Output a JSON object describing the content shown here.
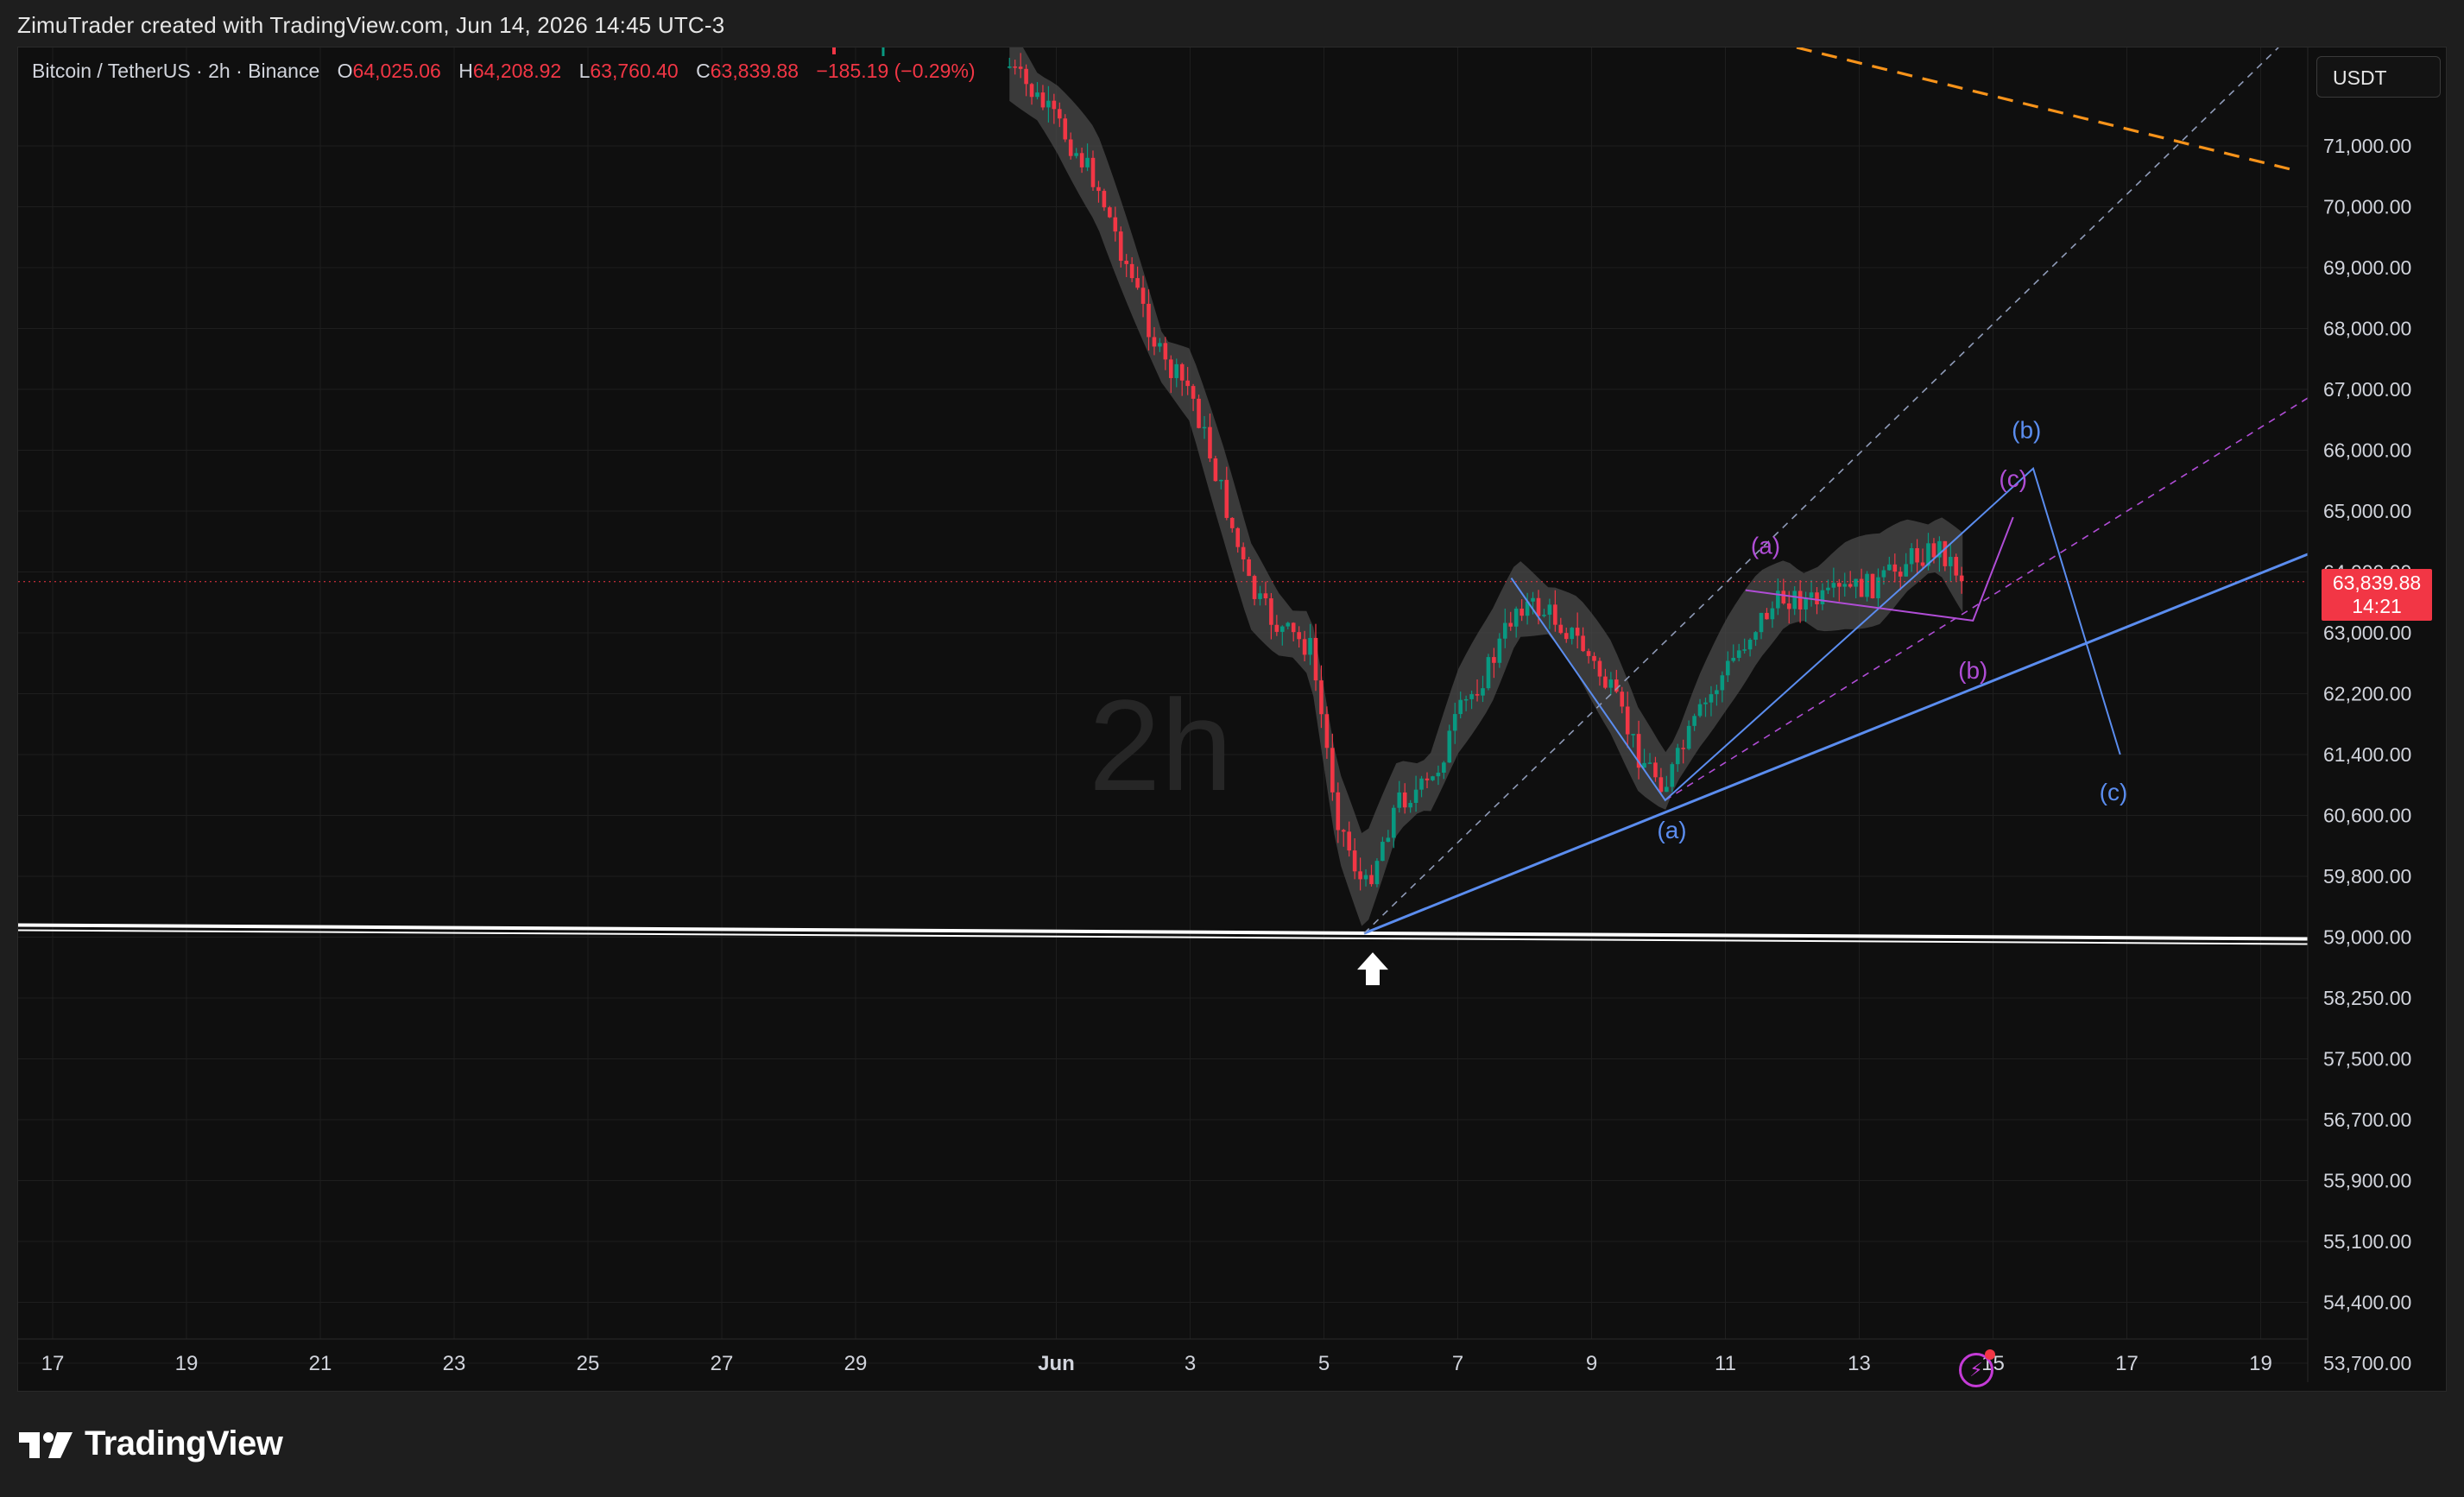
{
  "attribution": "ZimuTrader created with TradingView.com, Jun 14, 2026 14:45 UTC-3",
  "legend": {
    "symbol": "Bitcoin / TetherUS · 2h · Binance",
    "open_label": "O",
    "open": "64,025.06",
    "high_label": "H",
    "high": "64,208.92",
    "low_label": "L",
    "low": "63,760.40",
    "close_label": "C",
    "close": "63,839.88",
    "change": "−185.19 (−0.29%)"
  },
  "currency": "USDT",
  "price_tag": {
    "price": "63,839.88",
    "countdown": "14:21"
  },
  "watermark": "2h",
  "footer": {
    "brand": "TradingView"
  },
  "colors": {
    "bear": "#f23645",
    "bull": "#089981",
    "blue": "#5b8def",
    "purple": "#b04dd6",
    "orange": "#f7931a",
    "support": "#ffffff",
    "cloud": "#4a4a4a"
  },
  "icons": [
    "up-arrow-icon",
    "lightning-icon",
    "tradingview-logo-icon"
  ],
  "chart_data": {
    "type": "candlestick",
    "timeframe": "2h",
    "y_axis": {
      "labels": [
        "71,000.00",
        "70,000.00",
        "69,000.00",
        "68,000.00",
        "67,000.00",
        "66,000.00",
        "65,000.00",
        "64,000.00",
        "63,000.00",
        "62,200.00",
        "61,400.00",
        "60,600.00",
        "59,800.00",
        "59,000.00",
        "58,250.00",
        "57,500.00",
        "56,700.00",
        "55,900.00",
        "55,100.00",
        "54,400.00",
        "53,700.00"
      ],
      "values": [
        71000,
        70000,
        69000,
        68000,
        67000,
        66000,
        65000,
        64000,
        63000,
        62200,
        61400,
        60600,
        59800,
        59000,
        58250,
        57500,
        56700,
        55900,
        55100,
        54400,
        53700
      ]
    },
    "x_axis": {
      "labels": [
        "17",
        "19",
        "21",
        "23",
        "25",
        "27",
        "29",
        "Jun",
        "3",
        "5",
        "7",
        "9",
        "11",
        "13",
        "15",
        "17",
        "19"
      ],
      "dates": [
        "May 17",
        "May 19",
        "May 21",
        "May 23",
        "May 25",
        "May 27",
        "May 29",
        "Jun 1",
        "Jun 3",
        "Jun 5",
        "Jun 7",
        "Jun 9",
        "Jun 11",
        "Jun 13",
        "Jun 15",
        "Jun 17",
        "Jun 19"
      ]
    },
    "last_price": 63839.88,
    "price_path": [
      [
        "May 31.3",
        72300
      ],
      [
        "Jun 1.0",
        71400
      ],
      [
        "Jun 1.6",
        70400
      ],
      [
        "Jun 2.2",
        68600
      ],
      [
        "Jun 2.6",
        67400
      ],
      [
        "Jun 3.0",
        67000
      ],
      [
        "Jun 3.5",
        65200
      ],
      [
        "Jun 3.9",
        63700
      ],
      [
        "Jun 4.3",
        63100
      ],
      [
        "Jun 4.8",
        62800
      ],
      [
        "Jun 5.2",
        60600
      ],
      [
        "Jun 5.6",
        59600
      ],
      [
        "Jun 6.1",
        60800
      ],
      [
        "Jun 6.6",
        61000
      ],
      [
        "Jun 7.0",
        61900
      ],
      [
        "Jun 7.5",
        62600
      ],
      [
        "Jun 7.9",
        63500
      ],
      [
        "Jun 8.4",
        63300
      ],
      [
        "Jun 8.8",
        62900
      ],
      [
        "Jun 9.3",
        62200
      ],
      [
        "Jun 9.7",
        61400
      ],
      [
        "Jun 10.1",
        61000
      ],
      [
        "Jun 10.6",
        61900
      ],
      [
        "Jun 11.0",
        62500
      ],
      [
        "Jun 11.5",
        63200
      ],
      [
        "Jun 11.9",
        63600
      ],
      [
        "Jun 12.4",
        63500
      ],
      [
        "Jun 12.8",
        63700
      ],
      [
        "Jun 13.3",
        63800
      ],
      [
        "Jun 13.7",
        64200
      ],
      [
        "Jun 14.2",
        64400
      ],
      [
        "Jun 14.6",
        63840
      ]
    ],
    "annotations": {
      "wave_labels": [
        {
          "text": "(b)",
          "color": "blue",
          "date": "Jun 15.5",
          "price": 66200
        },
        {
          "text": "(c)",
          "color": "blue",
          "date": "Jun 16.8",
          "price": 60800
        },
        {
          "text": "(a)",
          "color": "blue",
          "date": "Jun 10.2",
          "price": 60300
        },
        {
          "text": "(a)",
          "color": "purple",
          "date": "Jun 11.6",
          "price": 64300
        },
        {
          "text": "(b)",
          "color": "purple",
          "date": "Jun 14.7",
          "price": 62400
        },
        {
          "text": "(c)",
          "color": "purple",
          "date": "Jun 15.3",
          "price": 65400
        }
      ],
      "support_price": 59000,
      "low_marker": {
        "date": "Jun 5.6",
        "price": 59050
      }
    }
  }
}
